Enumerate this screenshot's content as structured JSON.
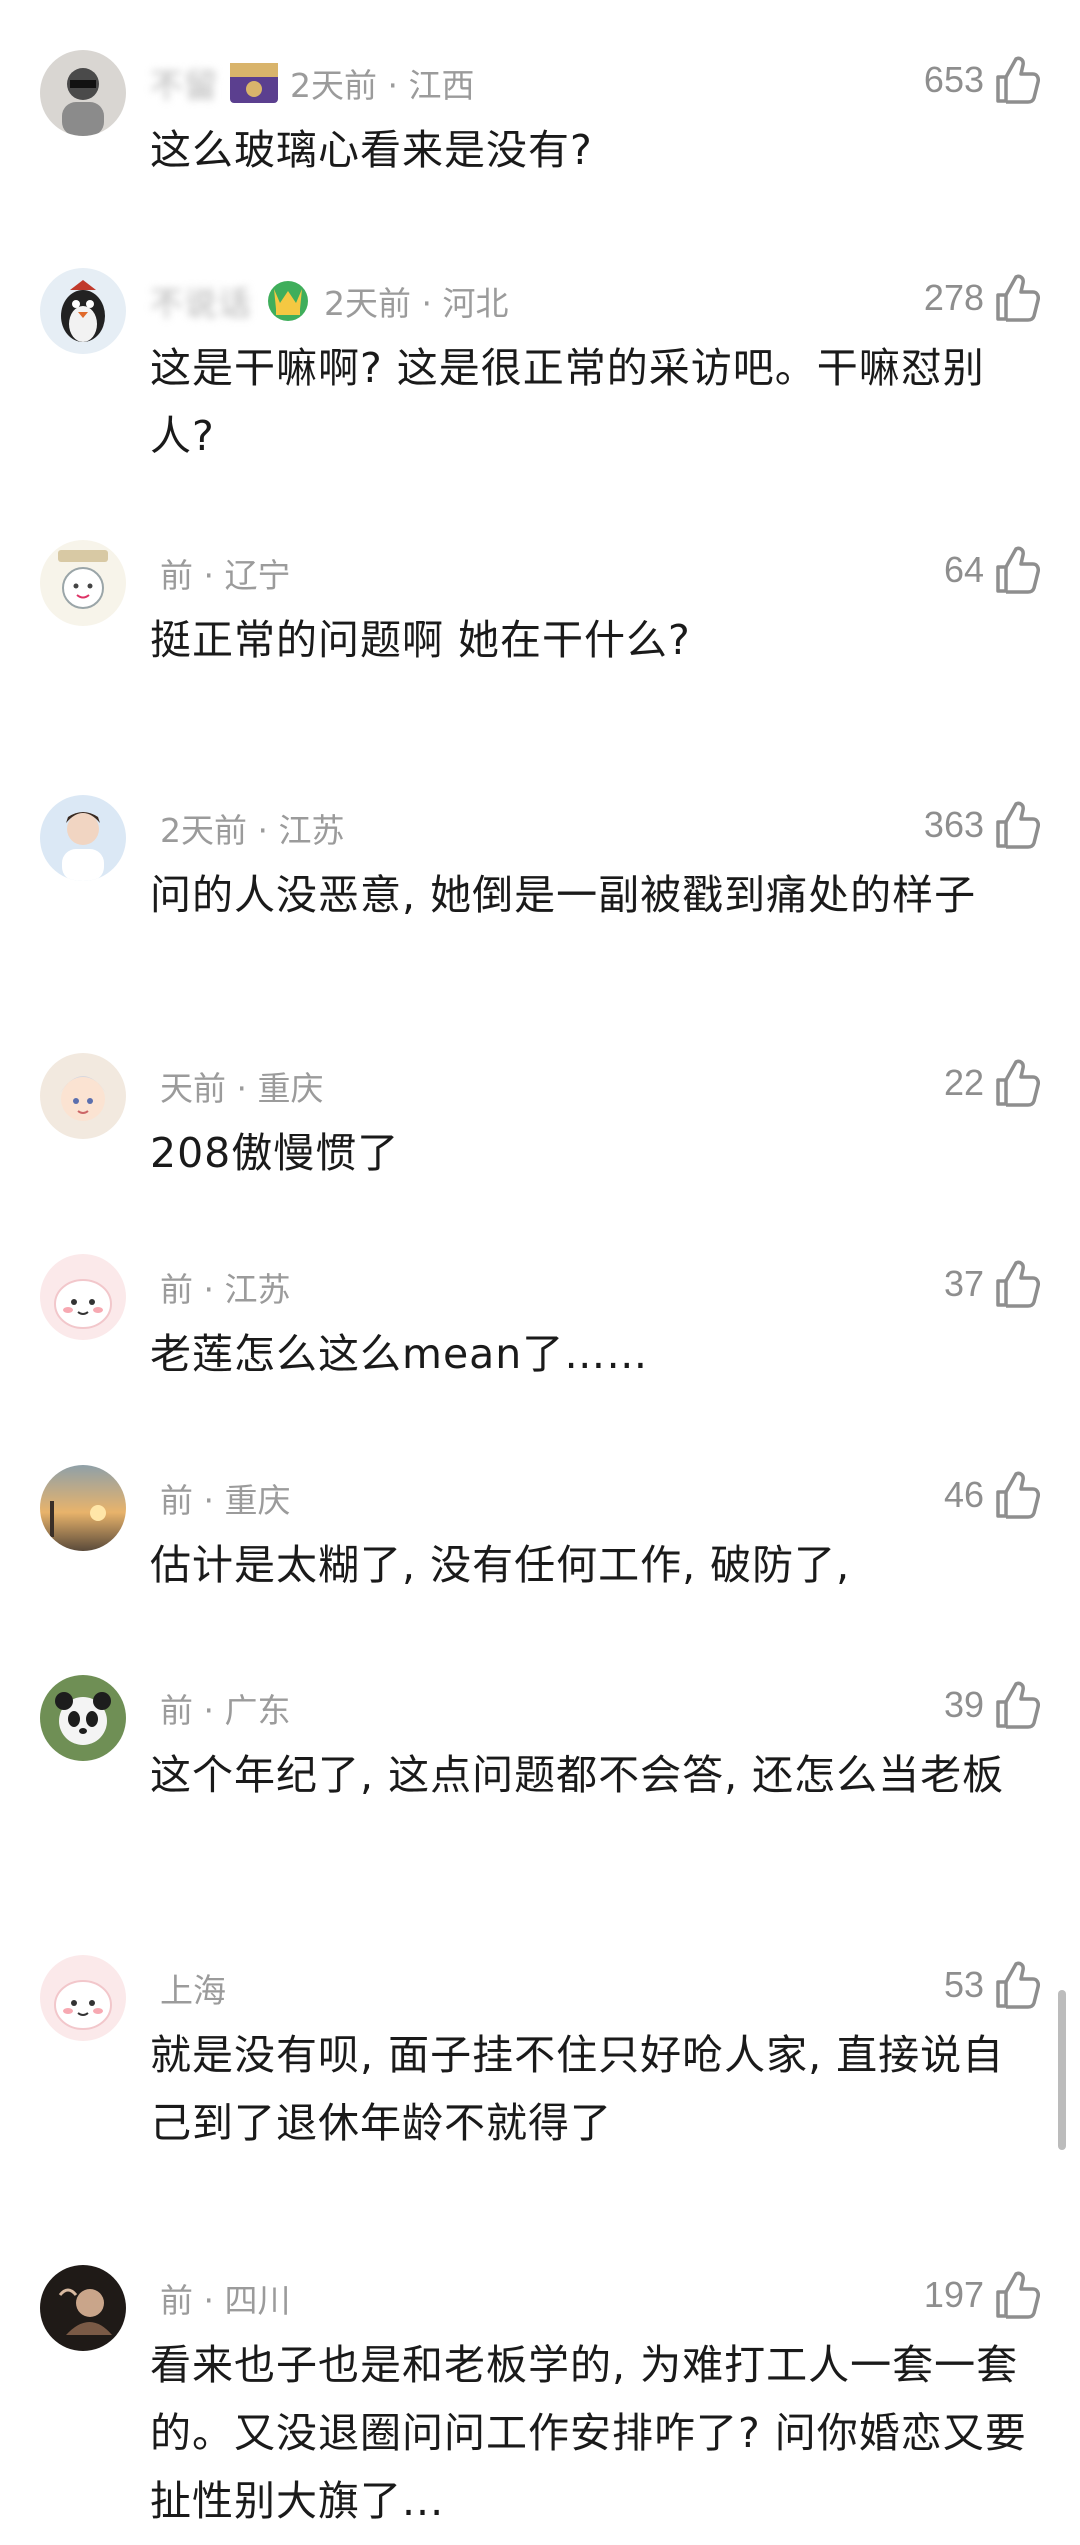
{
  "comments": [
    {
      "username": "不留",
      "time": "2天前",
      "location": "江西",
      "meta": "2天前 · 江西",
      "likes": "653",
      "text": "这么玻璃心看来是没有?"
    },
    {
      "username": "不说话",
      "time": "2天前",
      "location": "河北",
      "meta": "2天前 · 河北",
      "likes": "278",
      "text": "这是干嘛啊? 这是很正常的采访吧。干嘛怼别人?"
    },
    {
      "username": "",
      "time": "前",
      "location": "辽宁",
      "meta": "前 · 辽宁",
      "likes": "64",
      "text": "挺正常的问题啊 她在干什么?"
    },
    {
      "username": "",
      "time": "2天前",
      "location": "江苏",
      "meta": "2天前 · 江苏",
      "likes": "363",
      "text": "问的人没恶意, 她倒是一副被戳到痛处的样子"
    },
    {
      "username": "",
      "time": "天前",
      "location": "重庆",
      "meta": "天前 · 重庆",
      "likes": "22",
      "text": "208傲慢惯了"
    },
    {
      "username": "",
      "time": "前",
      "location": "江苏",
      "meta": "前 · 江苏",
      "likes": "37",
      "text": "老莲怎么这么mean了……"
    },
    {
      "username": "",
      "time": "前",
      "location": "重庆",
      "meta": "前 · 重庆",
      "likes": "46",
      "text": "估计是太糊了, 没有任何工作, 破防了,"
    },
    {
      "username": "",
      "time": "前",
      "location": "广东",
      "meta": "前 · 广东",
      "likes": "39",
      "text": "这个年纪了, 这点问题都不会答, 还怎么当老板"
    },
    {
      "username": "",
      "time": "",
      "location": "上海",
      "meta": "上海",
      "likes": "53",
      "text": "就是没有呗, 面子挂不住只好呛人家, 直接说自己到了退休年龄不就得了"
    },
    {
      "username": "",
      "time": "前",
      "location": "四川",
      "meta": "前 · 四川",
      "likes": "197",
      "text": "看来也子也是和老板学的, 为难打工人一套一套的。又没退圈问问工作安排咋了? 问你婚恋又要扯性别大旗了..."
    }
  ]
}
